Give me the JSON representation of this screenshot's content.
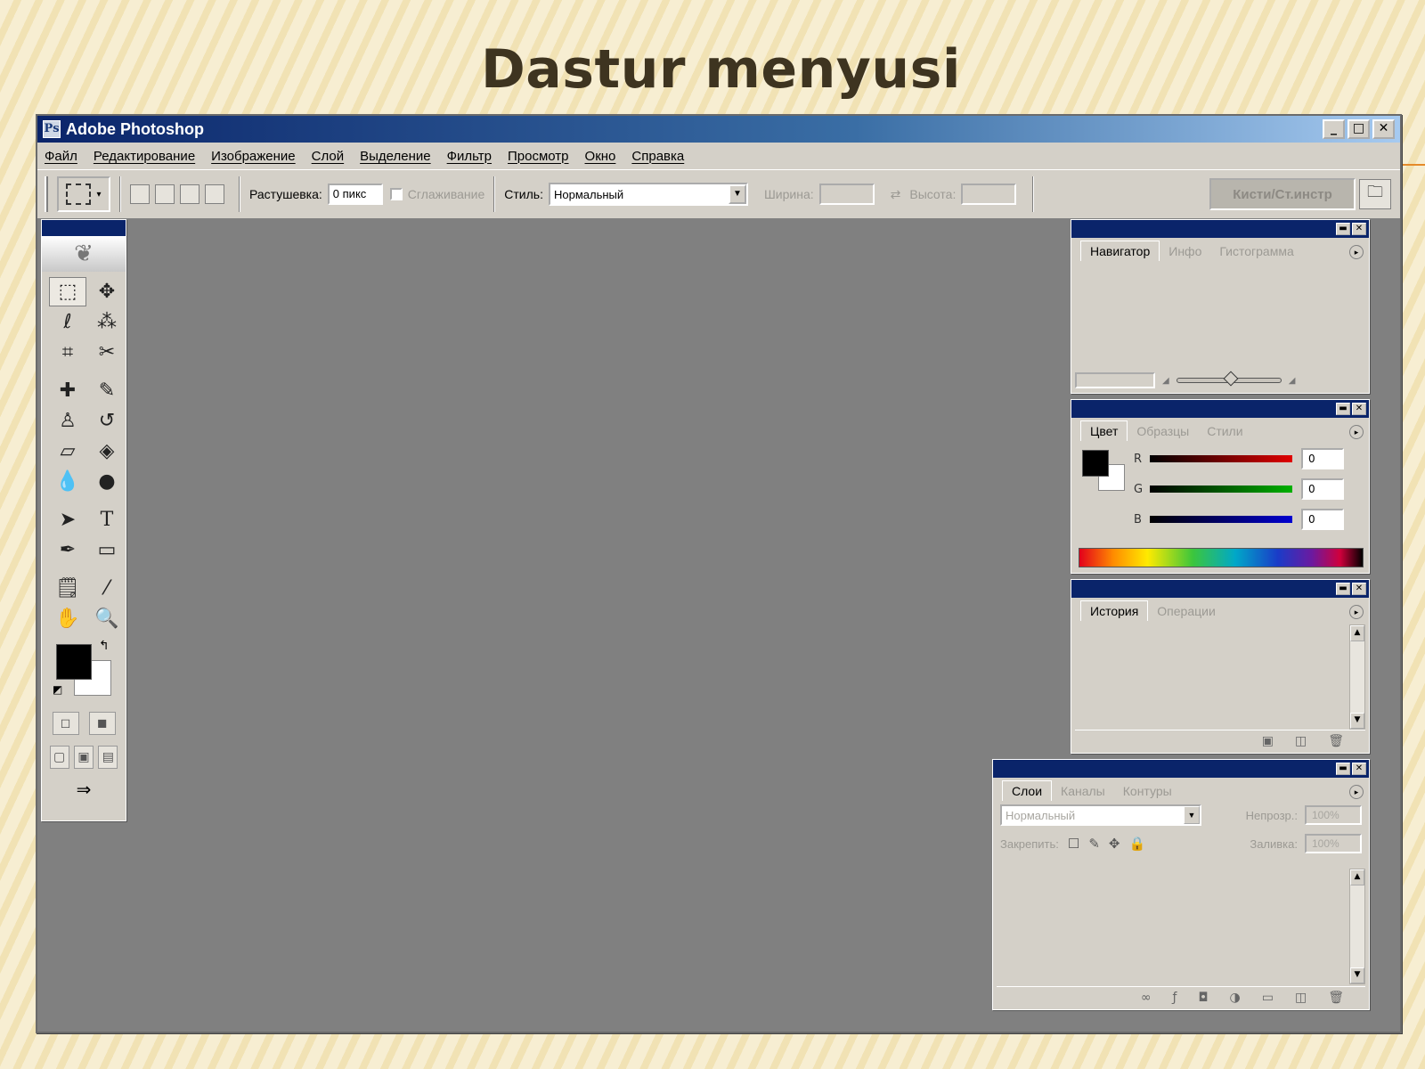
{
  "slide": {
    "bullet_glyph": "",
    "title": "Dastur menyusi"
  },
  "window": {
    "title": "Adobe Photoshop",
    "buttons": {
      "minimize": "_",
      "maximize": "□",
      "close": "✕"
    }
  },
  "menu": {
    "items": [
      "Файл",
      "Редактирование",
      "Изображение",
      "Слой",
      "Выделение",
      "Фильтр",
      "Просмотр",
      "Окно",
      "Справка"
    ]
  },
  "options_bar": {
    "feather_label": "Растушевка:",
    "feather_value": "0 пикс",
    "antialias_label": "Сглаживание",
    "style_label": "Стиль:",
    "style_value": "Нормальный",
    "width_label": "Ширина:",
    "height_label": "Высота:",
    "palette_well_label": "Кисти/Ст.инстр"
  },
  "toolbox": {
    "tools": [
      {
        "name": "rectangular-marquee-icon",
        "glyph": "⬚"
      },
      {
        "name": "move-tool-icon",
        "glyph": "✥"
      },
      {
        "name": "lasso-icon",
        "glyph": "ℓ"
      },
      {
        "name": "magic-wand-icon",
        "glyph": "⁂"
      },
      {
        "name": "crop-icon",
        "glyph": "⌗"
      },
      {
        "name": "slice-icon",
        "glyph": "✂"
      },
      {
        "name": "healing-brush-icon",
        "glyph": "✚"
      },
      {
        "name": "brush-icon",
        "glyph": "✎"
      },
      {
        "name": "clone-stamp-icon",
        "glyph": "♙"
      },
      {
        "name": "history-brush-icon",
        "glyph": "↺"
      },
      {
        "name": "eraser-icon",
        "glyph": "▱"
      },
      {
        "name": "paint-bucket-icon",
        "glyph": "◈"
      },
      {
        "name": "blur-icon",
        "glyph": "💧"
      },
      {
        "name": "dodge-icon",
        "glyph": "●"
      },
      {
        "name": "path-selection-icon",
        "glyph": "➤"
      },
      {
        "name": "type-icon",
        "glyph": "T"
      },
      {
        "name": "pen-icon",
        "glyph": "✒"
      },
      {
        "name": "rectangle-shape-icon",
        "glyph": "▭"
      },
      {
        "name": "notes-icon",
        "glyph": "🗒"
      },
      {
        "name": "eyedropper-icon",
        "glyph": "⁄"
      },
      {
        "name": "hand-icon",
        "glyph": "✋"
      },
      {
        "name": "zoom-icon",
        "glyph": "🔍"
      }
    ],
    "mask_modes": [
      "◻",
      "◼"
    ],
    "screen_modes": [
      "▢",
      "▣",
      "▤"
    ],
    "jump_glyph": "⇒"
  },
  "navigator_panel": {
    "tabs": [
      "Навигатор",
      "Инфо",
      "Гистограмма"
    ]
  },
  "color_panel": {
    "tabs": [
      "Цвет",
      "Образцы",
      "Стили"
    ],
    "channels": [
      {
        "label": "R",
        "value": "0",
        "color": "#e00000"
      },
      {
        "label": "G",
        "value": "0",
        "color": "#00b000"
      },
      {
        "label": "B",
        "value": "0",
        "color": "#0000d0"
      }
    ]
  },
  "history_panel": {
    "tabs": [
      "История",
      "Операции"
    ]
  },
  "layers_panel": {
    "tabs": [
      "Слои",
      "Каналы",
      "Контуры"
    ],
    "blend_mode": "Нормальный",
    "opacity_label": "Непрозр.:",
    "opacity_value": "100%",
    "lock_label": "Закрепить:",
    "fill_label": "Заливка:",
    "fill_value": "100%"
  },
  "colors": {
    "title_blue": "#0a246a",
    "workspace_gray": "#808080",
    "chrome": "#d4d0c8"
  }
}
